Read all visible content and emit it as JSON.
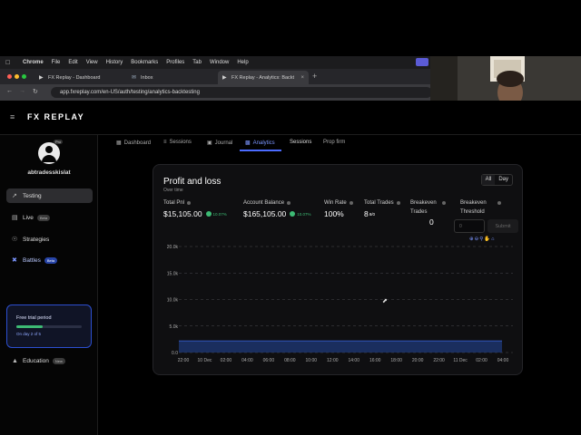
{
  "menubar": {
    "app": "Chrome",
    "items": [
      "File",
      "Edit",
      "View",
      "History",
      "Bookmarks",
      "Profiles",
      "Tab",
      "Window",
      "Help"
    ]
  },
  "browser": {
    "tabs": [
      {
        "label": "FX Replay - Dashboard",
        "icon": "fxreplay-favicon"
      },
      {
        "label": "Inbox",
        "icon": "mail-favicon"
      },
      {
        "label": "FX Replay - Analytics: Backt",
        "icon": "fxreplay-favicon"
      }
    ],
    "url": "app.fxreplay.com/en-US/auth/testing/analytics-backtesting"
  },
  "site": {
    "logo": "FX REPLAY"
  },
  "sidebar": {
    "pro_badge": "Pro",
    "username": "abtradesskislat",
    "nav": [
      {
        "label": "Testing",
        "icon": "chart-line-icon",
        "badge": ""
      },
      {
        "label": "Live",
        "icon": "broadcast-icon",
        "badge": "Beta"
      },
      {
        "label": "Strategies",
        "icon": "compass-icon",
        "badge": ""
      },
      {
        "label": "Battles",
        "icon": "cross-swords-icon",
        "badge": "Beta"
      }
    ],
    "trial": {
      "title": "Free trial period",
      "day": "On day 2 of 5",
      "progress": 0.4
    },
    "education": {
      "label": "Education",
      "badge": "New"
    }
  },
  "page_tabs": [
    {
      "label": "Dashboard",
      "icon": "grid-icon"
    },
    {
      "label": "Sessions",
      "icon": "list-icon"
    },
    {
      "label": "Journal",
      "icon": "journal-icon"
    },
    {
      "label": "Analytics",
      "icon": "bar-chart-icon"
    },
    {
      "label": "Sessions",
      "icon": ""
    },
    {
      "label": "Prop firm",
      "icon": ""
    }
  ],
  "card": {
    "title": "Profit and loss",
    "subtitle": "Over time",
    "toggle": [
      "All",
      "Day"
    ],
    "stats": {
      "total_pnl": {
        "label": "Total Pnl",
        "value": "$15,105.00",
        "change": "10.07%"
      },
      "account_balance": {
        "label": "Account Balance",
        "value": "$165,105.00",
        "change": "10.07%"
      },
      "win_rate": {
        "label": "Win Rate",
        "value": "100%"
      },
      "total_trades": {
        "label": "Total Trades",
        "value": "8",
        "sup": "8/0"
      },
      "breakeven_trades": {
        "label1": "Breakeven",
        "label2": "Trades",
        "value": "0"
      },
      "breakeven_threshold": {
        "label1": "Breakeven",
        "label2": "Threshold",
        "placeholder": "0",
        "submit": "Submit"
      }
    }
  },
  "colors": {
    "accent": "#4b6bff",
    "positive": "#3dba74",
    "area": "#1f3a78"
  },
  "chart_data": {
    "type": "area",
    "title": "Profit and loss",
    "x": [
      "22:00",
      "10 Dec",
      "02:00",
      "04:00",
      "06:00",
      "08:00",
      "10:00",
      "12:00",
      "14:00",
      "16:00",
      "18:00",
      "20:00",
      "22:00",
      "11 Dec",
      "02:00",
      "04:00"
    ],
    "y_ticks": [
      "0.0",
      "5.0k",
      "10.0k",
      "15.0k",
      "20.0k"
    ],
    "values": [
      2200,
      2200,
      2200,
      2200,
      2200,
      2200,
      2200,
      2200,
      2200,
      2200,
      2200,
      2200,
      2200,
      2200,
      2200,
      2200
    ],
    "ylim": [
      0,
      20000
    ],
    "grid": true
  }
}
